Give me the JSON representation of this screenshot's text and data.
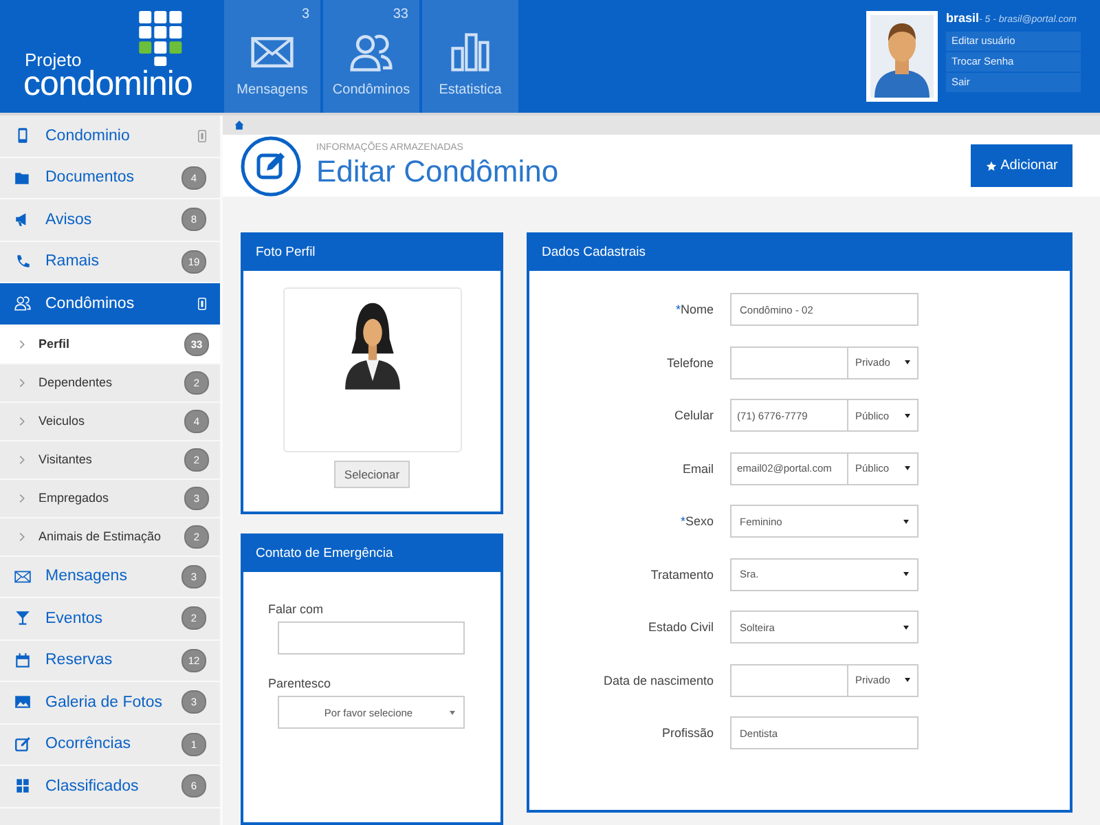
{
  "logo": {
    "line1": "Projeto",
    "line2": "condominio"
  },
  "nav": [
    {
      "label": "Mensagens",
      "count": "3"
    },
    {
      "label": "Condôminos",
      "count": "33"
    },
    {
      "label": "Estatistica"
    }
  ],
  "user": {
    "name": "brasil",
    "info": " - 5 - brasil@portal.com",
    "menu": [
      "Editar usuário",
      "Trocar Senha",
      "Sair"
    ]
  },
  "sidebar": [
    {
      "label": "Condominio",
      "kind": "toggle",
      "selected": false
    },
    {
      "label": "Documentos",
      "kind": "count",
      "badge": "4",
      "selected": false
    },
    {
      "label": "Avisos",
      "kind": "count",
      "badge": "8",
      "selected": false
    },
    {
      "label": "Ramais",
      "kind": "count",
      "badge": "19",
      "selected": false
    },
    {
      "label": "Condôminos",
      "kind": "toggle",
      "selected": true,
      "children": [
        {
          "label": "Perfil",
          "badge": "33",
          "selected": true
        },
        {
          "label": "Dependentes",
          "badge": "2",
          "selected": false
        },
        {
          "label": "Veiculos",
          "badge": "4",
          "selected": false
        },
        {
          "label": "Visitantes",
          "badge": "2",
          "selected": false
        },
        {
          "label": "Empregados",
          "badge": "3",
          "selected": false
        },
        {
          "label": "Animais de Estimação",
          "badge": "2",
          "selected": false
        }
      ]
    },
    {
      "label": "Mensagens",
      "kind": "count",
      "badge": "3",
      "selected": false
    },
    {
      "label": "Eventos",
      "kind": "count",
      "badge": "2",
      "selected": false
    },
    {
      "label": "Reservas",
      "kind": "count",
      "badge": "12",
      "selected": false
    },
    {
      "label": "Galeria de Fotos",
      "kind": "count",
      "badge": "3",
      "selected": false
    },
    {
      "label": "Ocorrências",
      "kind": "count",
      "badge": "1",
      "selected": false
    },
    {
      "label": "Classificados",
      "kind": "count",
      "badge": "6",
      "selected": false
    }
  ],
  "page": {
    "subtitle": "INFORMAÇÕES ARMAZENADAS",
    "title": "Editar Condômino",
    "action": "Adicionar"
  },
  "photo_panel": {
    "title": "Foto Perfil",
    "button": "Selecionar"
  },
  "emergency_panel": {
    "title": "Contato de Emergência",
    "fields": [
      {
        "label": "Falar com",
        "kind": "text"
      },
      {
        "label": "Parentesco",
        "kind": "select",
        "value": "Por favor selecione"
      }
    ]
  },
  "form_panel": {
    "title": "Dados Cadastrais",
    "fields": [
      {
        "label": "Nome",
        "mark": "*",
        "kind": "text",
        "value": "Condômino - 02"
      },
      {
        "label": "Telefone",
        "kind": "privacy",
        "privacy": "Privado"
      },
      {
        "label": "Celular",
        "kind": "privacy",
        "value": "(71) 6776-7779",
        "privacy": "Público"
      },
      {
        "label": "Email",
        "kind": "privacy",
        "value": "email02@portal.com",
        "privacy": "Público"
      },
      {
        "label": "Sexo",
        "mark": "*",
        "kind": "select",
        "value": "Feminino"
      },
      {
        "label": "Tratamento",
        "kind": "select",
        "value": "Sra."
      },
      {
        "label": "Estado Civil",
        "kind": "select",
        "value": "Solteira"
      },
      {
        "label": "Data de nascimento",
        "kind": "privacy",
        "privacy": "Privado"
      },
      {
        "label": "Profissão",
        "kind": "text",
        "value": "Dentista"
      }
    ]
  }
}
